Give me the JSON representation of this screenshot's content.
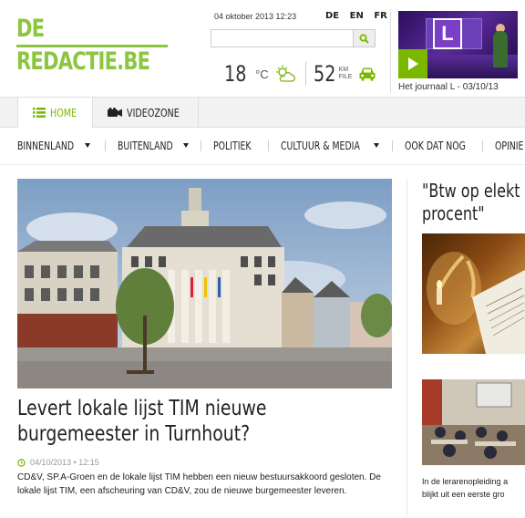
{
  "logo": {
    "line1": "DE",
    "line2": "REDACTIE.BE"
  },
  "header": {
    "datetime": "04 oktober 2013 12:23",
    "languages": [
      "DE",
      "EN",
      "FR"
    ],
    "search_placeholder": "",
    "temperature": "18",
    "temperature_unit": "°C",
    "traffic_km": "52",
    "traffic_label_1": "KM",
    "traffic_label_2": "FILE",
    "weather_icon": "partly-sunny-icon",
    "traffic_icon": "car-icon"
  },
  "video": {
    "caption": "Het journaal L - 03/10/13",
    "thumb_letter": "L"
  },
  "tabs": [
    {
      "label": "HOME",
      "icon": "list-icon",
      "active": true
    },
    {
      "label": "VIDEOZONE",
      "icon": "camera-icon",
      "active": false
    }
  ],
  "nav": [
    {
      "label": "BINNENLAND",
      "dropdown": true
    },
    {
      "label": "BUITENLAND",
      "dropdown": true
    },
    {
      "label": "POLITIEK",
      "dropdown": false
    },
    {
      "label": "CULTUUR & MEDIA",
      "dropdown": true
    },
    {
      "label": "OOK DAT NOG",
      "dropdown": false
    },
    {
      "label": "OPINIE",
      "dropdown": false
    }
  ],
  "main_article": {
    "title": "Levert lokale lijst TIM nieuwe burgemeester in Turnhout?",
    "meta": "04/10/2013 • 12:15",
    "description": "CD&V, SP.A-Groen en de lokale lijst TIM hebben een nieuw bestuursakkoord gesloten. De lokale lijst TIM, een afscheuring van CD&V, zou de nieuwe burgemeester leveren."
  },
  "side_article": {
    "title_line1": "\"Btw op elekt",
    "title_line2": "procent\"",
    "desc_line1": "In de lerarenopleiding a",
    "desc_line2": "blijkt uit een eerste gro"
  },
  "colors": {
    "brand_green": "#8cc63f",
    "accent_green": "#7ab800"
  }
}
